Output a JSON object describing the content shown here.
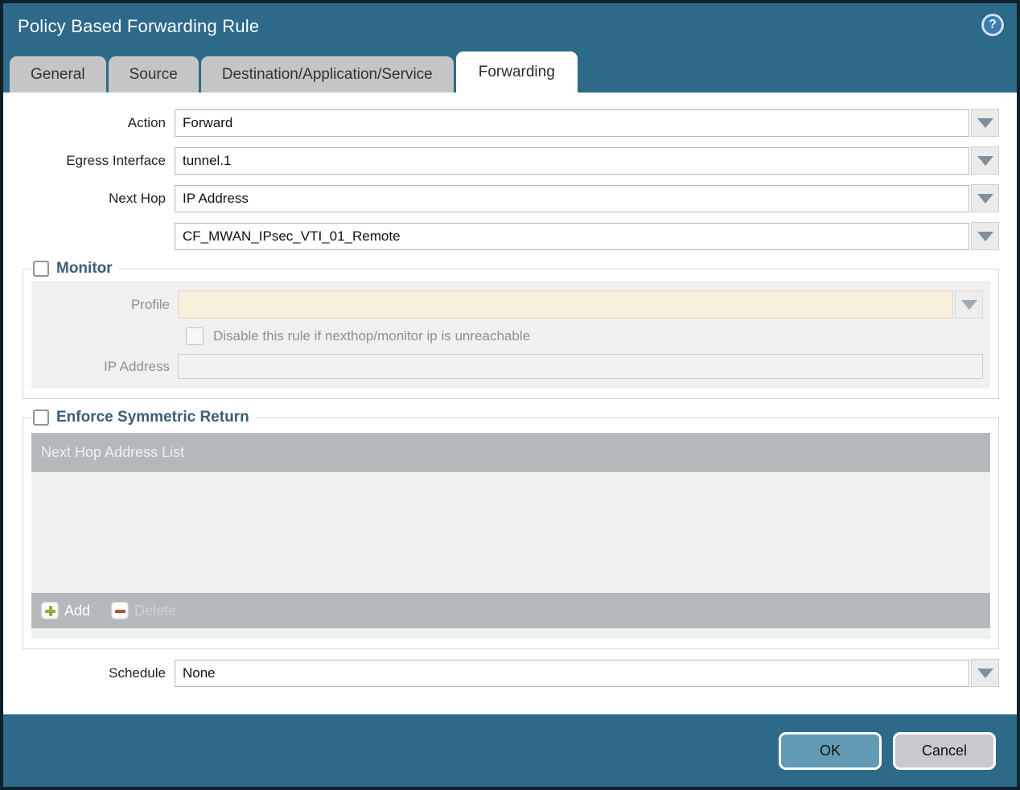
{
  "dialog": {
    "title": "Policy Based Forwarding Rule"
  },
  "icons": {
    "help_glyph": "?"
  },
  "tabs": [
    {
      "label": "General",
      "active": false
    },
    {
      "label": "Source",
      "active": false
    },
    {
      "label": "Destination/Application/Service",
      "active": false
    },
    {
      "label": "Forwarding",
      "active": true
    }
  ],
  "form": {
    "action": {
      "label": "Action",
      "value": "Forward"
    },
    "egress_interface": {
      "label": "Egress Interface",
      "value": "tunnel.1"
    },
    "next_hop": {
      "label": "Next Hop",
      "value": "IP Address"
    },
    "next_hop_address": {
      "value": "CF_MWAN_IPsec_VTI_01_Remote"
    },
    "schedule": {
      "label": "Schedule",
      "value": "None"
    }
  },
  "monitor": {
    "legend": "Monitor",
    "checked": false,
    "profile_label": "Profile",
    "profile_value": "",
    "disable_checkbox_label": "Disable this rule if nexthop/monitor ip is unreachable",
    "disable_checkbox_checked": false,
    "ip_address_label": "IP Address",
    "ip_address_value": ""
  },
  "symmetric_return": {
    "legend": "Enforce Symmetric Return",
    "checked": false,
    "table_header": "Next Hop Address List",
    "rows": [],
    "add_label": "Add",
    "delete_label": "Delete",
    "delete_enabled": false
  },
  "footer": {
    "ok_label": "OK",
    "cancel_label": "Cancel"
  },
  "colors": {
    "titlebar_teal": "#2d6a8a",
    "active_tab": "#ffffff",
    "inactive_tab": "#c5c5c5",
    "table_header_gray": "#b3b9bb",
    "disabled_profile_input": "#f5efdb",
    "legend_text": "#3d5d77",
    "ok_button": "#649bb4",
    "cancel_button": "#c9c9cd",
    "add_plus_green": "#8fae3c",
    "delete_minus_red": "#a8543e"
  }
}
